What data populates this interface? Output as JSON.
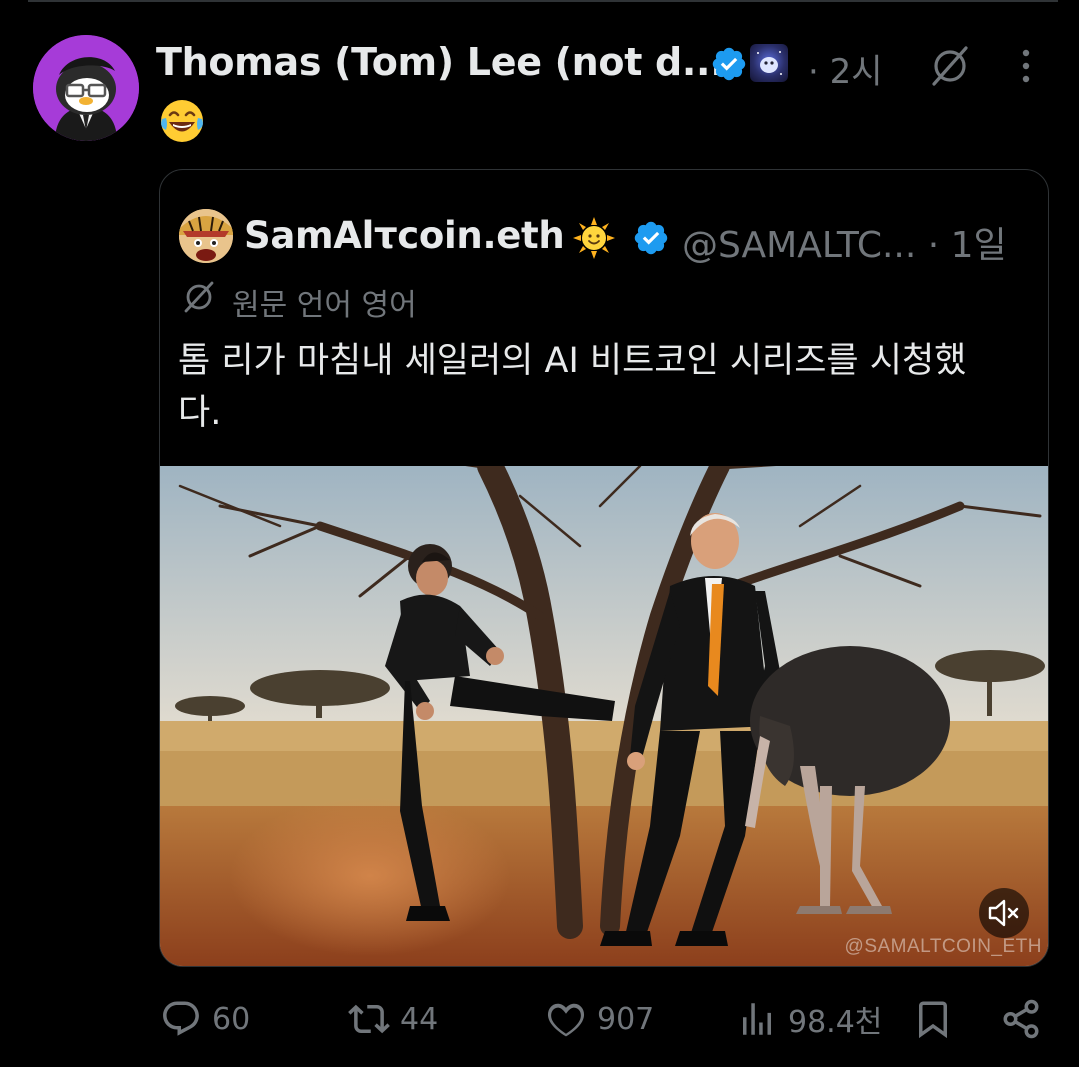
{
  "post": {
    "author_name": "Thomas (Tom) Lee (not d...",
    "time": "· 2시",
    "text_emoji": "😂"
  },
  "quote": {
    "author_name": "SamAlτcoin.eth",
    "handle": "@SAMALTC...",
    "time": "· 1일",
    "translate_label": "원문 언어 영어",
    "text": "톰 리가 마침내 세일러의 AI 비트코인 시리즈를 시청했다.",
    "watermark": "@SAMALTCOIN_ETH"
  },
  "actions": {
    "replies": "60",
    "reposts": "44",
    "likes": "907",
    "views": "98.4천"
  },
  "colors": {
    "background": "#000000",
    "text_primary": "#e7e9ea",
    "text_secondary": "#71767b",
    "verified": "#1d9bf0",
    "border": "#2f3336",
    "avatar_bg": "#a63bd8"
  },
  "icons": [
    "verified-badge-icon",
    "game-badge-icon",
    "grok-icon",
    "more-icon",
    "laughing-emoji-icon",
    "sun-emoji-icon",
    "translate-icon",
    "mute-icon",
    "reply-icon",
    "repost-icon",
    "like-icon",
    "views-icon",
    "bookmark-icon",
    "share-icon"
  ]
}
